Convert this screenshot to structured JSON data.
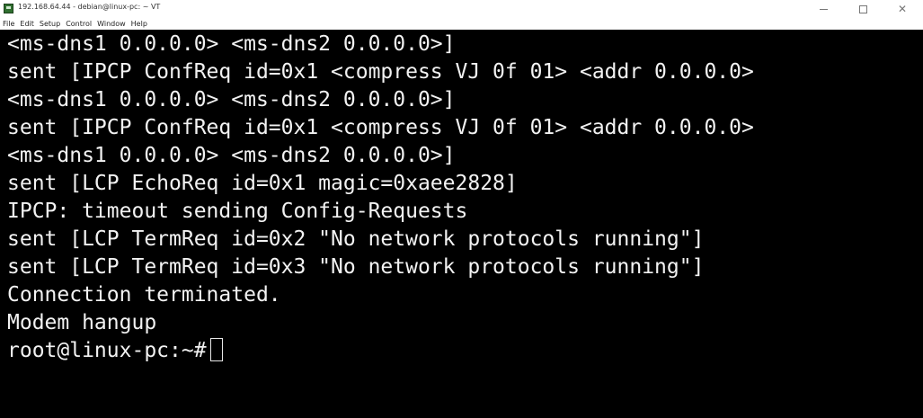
{
  "window": {
    "title": "192.168.64.44 - debian@linux-pc: ~ VT",
    "icon": "terminal-app-icon",
    "controls": [
      "minimize-icon",
      "maximize-icon",
      "close-icon"
    ]
  },
  "menu": {
    "items": [
      {
        "label": "File"
      },
      {
        "label": "Edit"
      },
      {
        "label": "Setup"
      },
      {
        "label": "Control"
      },
      {
        "label": "Window"
      },
      {
        "label": "Help"
      }
    ]
  },
  "terminal": {
    "lines": [
      "<ms-dns1 0.0.0.0> <ms-dns2 0.0.0.0>]",
      "sent [IPCP ConfReq id=0x1 <compress VJ 0f 01> <addr 0.0.0.0>",
      "<ms-dns1 0.0.0.0> <ms-dns2 0.0.0.0>]",
      "sent [IPCP ConfReq id=0x1 <compress VJ 0f 01> <addr 0.0.0.0>",
      "<ms-dns1 0.0.0.0> <ms-dns2 0.0.0.0>]",
      "sent [LCP EchoReq id=0x1 magic=0xaee2828]",
      "IPCP: timeout sending Config-Requests",
      "sent [LCP TermReq id=0x2 \"No network protocols running\"]",
      "sent [LCP TermReq id=0x3 \"No network protocols running\"]",
      "Connection terminated.",
      "Modem hangup"
    ],
    "prompt": "root@linux-pc:~#",
    "colors": {
      "background": "#000000",
      "foreground": "#f2f2f2"
    }
  }
}
